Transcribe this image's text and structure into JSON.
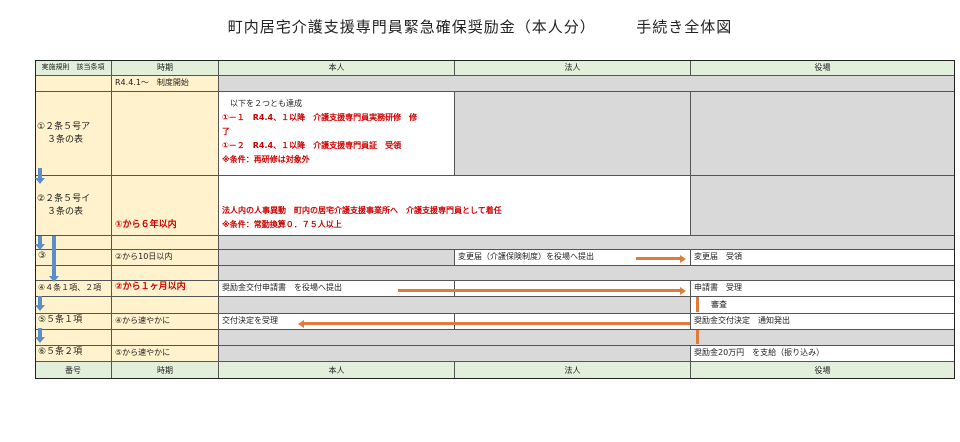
{
  "title": "町内居宅介護支援専門員緊急確保奨励金（本人分）　　　手続き全体図",
  "header": {
    "col1": "実施規則　該当条項",
    "col2": "時期",
    "col3": "本人",
    "col4": "法人",
    "col5": "役場"
  },
  "footer": {
    "col1": "番号",
    "col2": "時期",
    "col3": "本人",
    "col4": "法人",
    "col5": "役場"
  },
  "rows": {
    "start_time": "R4.4.1～　制度開始",
    "r1_clause_a": "①２条５号ア",
    "r1_clause_b": "３条の表",
    "r1_intro": "以下を２つとも達成",
    "r1_line1": "①－１　R4.4、１以降　介護支援専門員実務研修　修",
    "r1_line1b": "了",
    "r1_line2": "①－２　R4.4、１以降　介護支援専門員証　受領",
    "r1_line3": "※条件：再研修は対象外",
    "r2_clause_a": "②２条５号イ",
    "r2_clause_b": "３条の表",
    "r2_time": "①から６年以内",
    "r2_line1": "法人内の人事異動　町内の居宅介護支援事業所へ　介護支援専門員として着任",
    "r2_line2": "※条件：常勤換算０．７５人以上",
    "r3_clause": "③",
    "r3_time": "②から10日以内",
    "r3_corp": "変更届（介護保険制度）を役場へ提出",
    "r3_office": "変更届　受領",
    "r4_clause": "④４条１項、２項",
    "r4_time": "②から１ヶ月以内",
    "r4_self": "奨励金交付申請書　を役場へ提出",
    "r4_office": "申請書　受理",
    "r4_office_b": "審査",
    "r5_clause": "⑤５条１項",
    "r5_time": "④から速やかに",
    "r5_self": "交付決定を受理",
    "r5_office": "奨励金交付決定　通知発出",
    "r6_clause": "⑥５条２項",
    "r6_time": "⑤から速やかに",
    "r6_office": "奨励金20万円　を支給（振り込み）"
  }
}
